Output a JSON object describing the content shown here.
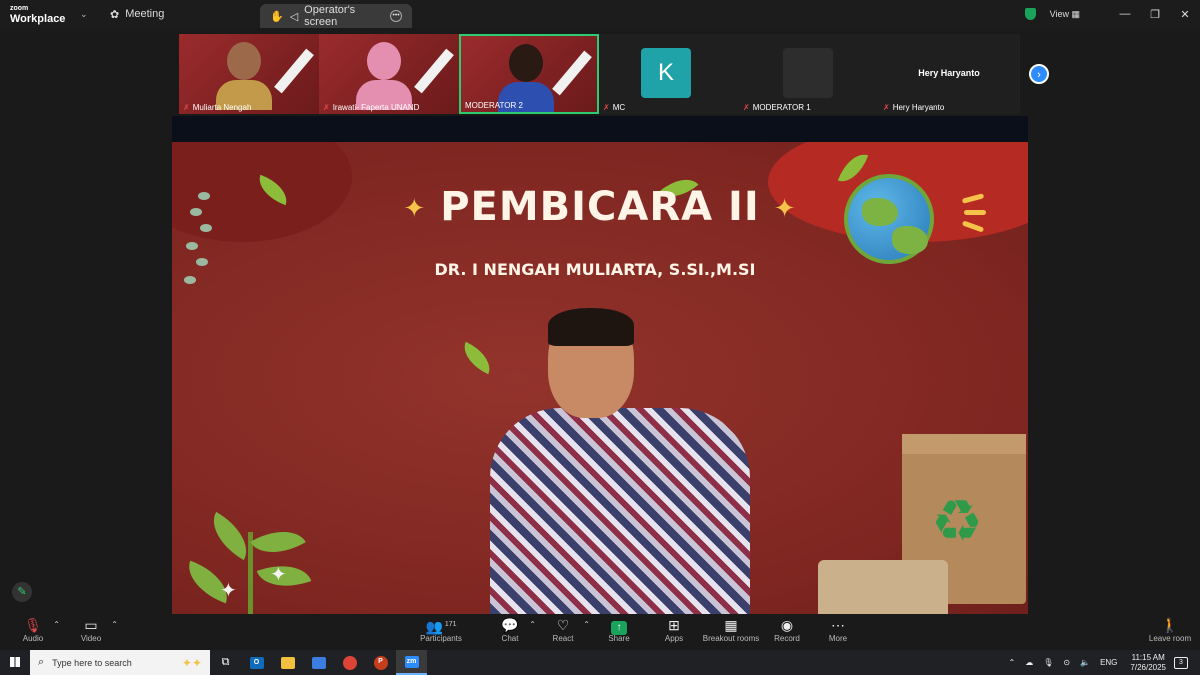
{
  "titlebar": {
    "brand_top": "zoom",
    "brand_bottom": "Workplace",
    "tab_meeting": "Meeting",
    "tab_screen": "Operator's screen",
    "view_label": "View"
  },
  "gallery": {
    "tiles": [
      {
        "name": "Muliarta Nengah",
        "type": "video"
      },
      {
        "name": "Irawati- Faperta UNAND",
        "type": "video"
      },
      {
        "name": "MODERATOR 2",
        "type": "video",
        "active": true
      },
      {
        "name": "MC",
        "type": "avatar",
        "initial": "K"
      },
      {
        "name": "MODERATOR 1",
        "type": "blank"
      },
      {
        "name": "Hery Haryanto",
        "type": "text",
        "display": "Hery Haryanto"
      }
    ]
  },
  "slide": {
    "title": "PEMBICARA II",
    "subtitle": "DR. I NENGAH MULIARTA, S.SI.,M.SI"
  },
  "toolbar": {
    "audio": "Audio",
    "video": "Video",
    "participants": "Participants",
    "participants_count": "171",
    "chat": "Chat",
    "react": "React",
    "share": "Share",
    "apps": "Apps",
    "breakout": "Breakout rooms",
    "record": "Record",
    "more": "More",
    "leave": "Leave room"
  },
  "taskbar": {
    "search_placeholder": "Type here to search",
    "lang": "ENG",
    "time": "11:15 AM",
    "date": "7/26/2025",
    "notif_count": "3"
  },
  "colors": {
    "zoom_blue": "#2d8cff",
    "slide_red": "#8b2c27",
    "active_border": "#2ecc71",
    "mute_red": "#e04848"
  }
}
